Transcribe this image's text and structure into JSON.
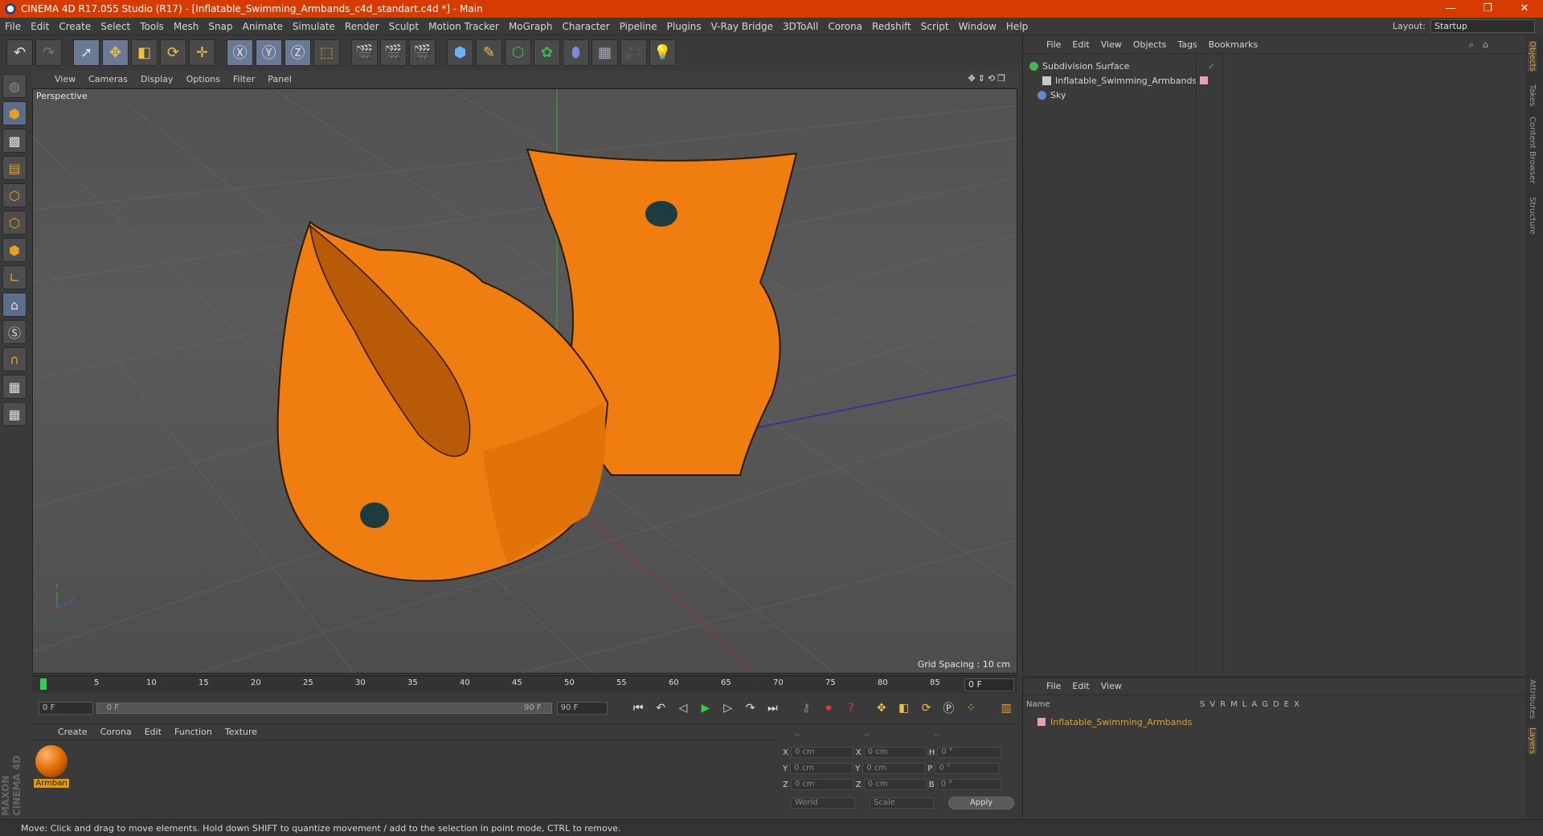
{
  "window": {
    "title": "CINEMA 4D R17.055 Studio (R17) - [Inflatable_Swimming_Armbands_c4d_standart.c4d *] - Main",
    "controls": [
      "—",
      "❐",
      "✕"
    ]
  },
  "menubar": {
    "items": [
      "File",
      "Edit",
      "Create",
      "Select",
      "Tools",
      "Mesh",
      "Snap",
      "Animate",
      "Simulate",
      "Render",
      "Sculpt",
      "Motion Tracker",
      "MoGraph",
      "Character",
      "Pipeline",
      "Plugins",
      "V-Ray Bridge",
      "3DToAll",
      "Corona",
      "Redshift",
      "Script",
      "Window",
      "Help"
    ],
    "layout_label": "Layout:",
    "layout_value": "Startup"
  },
  "viewport": {
    "menu": [
      "View",
      "Cameras",
      "Display",
      "Options",
      "Filter",
      "Panel"
    ],
    "camera_label": "Perspective",
    "grid_spacing": "Grid Spacing : 10 cm",
    "nav_icons": "✥⇕⟲❐"
  },
  "timeline": {
    "ticks": [
      "0",
      "5",
      "10",
      "15",
      "20",
      "25",
      "30",
      "35",
      "40",
      "45",
      "50",
      "55",
      "60",
      "65",
      "70",
      "75",
      "80",
      "85",
      "90"
    ],
    "current_frame": "0 F",
    "start_field": "0 F",
    "range_start": "0 F",
    "range_end": "90 F",
    "end_field": "90 F"
  },
  "material_manager": {
    "menu": [
      "Create",
      "Corona",
      "Edit",
      "Function",
      "Texture"
    ],
    "materials": [
      {
        "name": "Armban"
      }
    ]
  },
  "coordinates": {
    "header": [
      "--",
      "--",
      "--"
    ],
    "rows": [
      {
        "a": "X",
        "av": "0 cm",
        "b": "X",
        "bv": "0 cm",
        "c": "H",
        "cv": "0 °"
      },
      {
        "a": "Y",
        "av": "0 cm",
        "b": "Y",
        "bv": "0 cm",
        "c": "P",
        "cv": "0 °"
      },
      {
        "a": "Z",
        "av": "0 cm",
        "b": "Z",
        "bv": "0 cm",
        "c": "B",
        "cv": "0 °"
      }
    ],
    "mode": "World",
    "size_mode": "Scale",
    "apply": "Apply"
  },
  "object_manager": {
    "menu": [
      "File",
      "Edit",
      "View",
      "Objects",
      "Tags",
      "Bookmarks"
    ],
    "objects": [
      {
        "name": "Subdivision Surface",
        "icon_color": "#3fb84f"
      },
      {
        "name": "Inflatable_Swimming_Armbands",
        "icon_color": "#c8c8c8"
      },
      {
        "name": "Sky",
        "icon_color": "#5c8ad6"
      }
    ]
  },
  "layer_manager": {
    "menu": [
      "File",
      "Edit",
      "View"
    ],
    "columns": [
      "Name",
      "S",
      "V",
      "R",
      "M",
      "L",
      "A",
      "G",
      "D",
      "E",
      "X"
    ],
    "layers": [
      {
        "name": "Inflatable_Swimming_Armbands",
        "color": "#e6a020"
      }
    ]
  },
  "right_tabs": [
    "Objects",
    "Takes",
    "Content Browser",
    "Structure",
    "Attributes",
    "Layers"
  ],
  "brand": "MAXON CINEMA 4D",
  "status": "Move: Click and drag to move elements. Hold down SHIFT to quantize movement / add to the selection in point mode, CTRL to remove.",
  "colors": {
    "accent": "#e6a020",
    "titlebar": "#d83b01",
    "armband": "#f08010"
  }
}
